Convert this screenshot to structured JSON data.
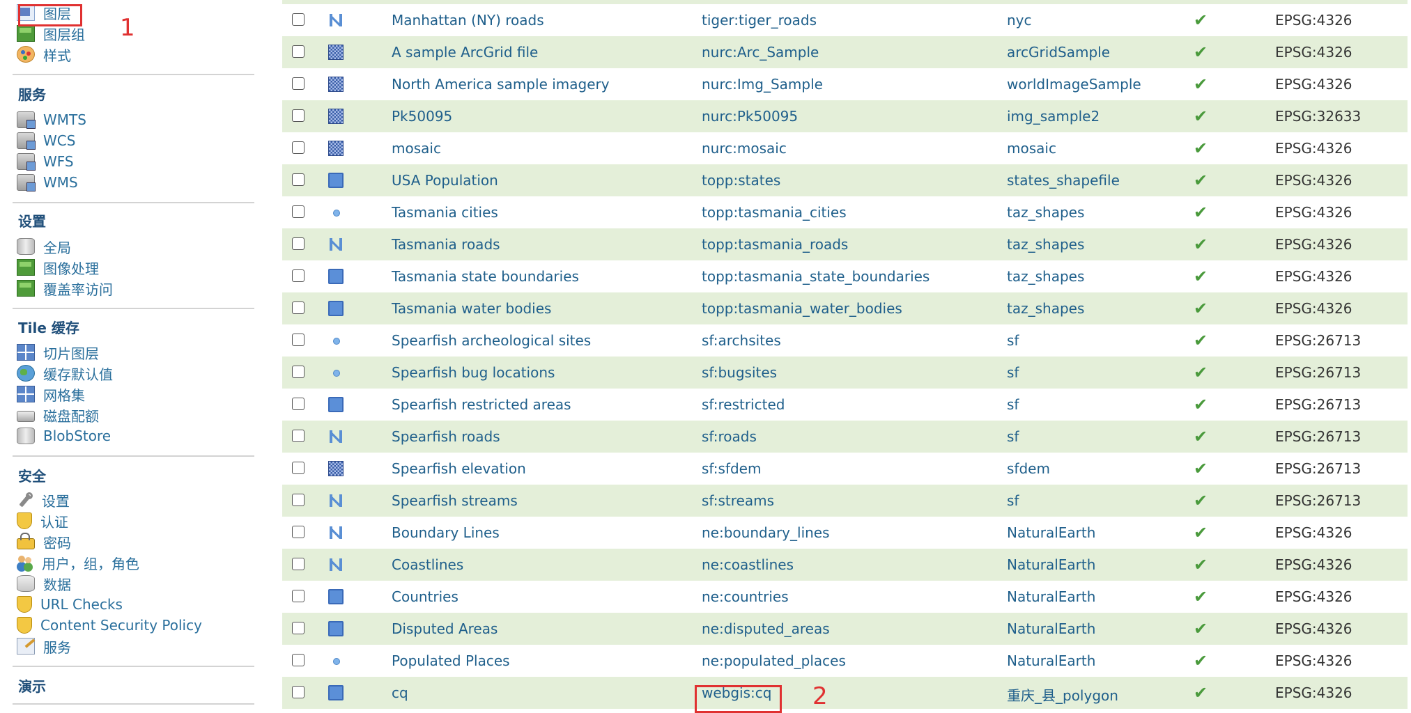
{
  "sidebar": {
    "data_items": [
      {
        "label": "图层",
        "icon": "layer-page-icon"
      },
      {
        "label": "图层组",
        "icon": "layer-group-icon"
      },
      {
        "label": "样式",
        "icon": "palette-icon"
      }
    ],
    "services": {
      "heading": "服务",
      "items": [
        {
          "label": "WMTS",
          "icon": "service-icon"
        },
        {
          "label": "WCS",
          "icon": "service-icon"
        },
        {
          "label": "WFS",
          "icon": "service-icon"
        },
        {
          "label": "WMS",
          "icon": "service-icon"
        }
      ]
    },
    "settings": {
      "heading": "设置",
      "items": [
        {
          "label": "全局",
          "icon": "server-icon"
        },
        {
          "label": "图像处理",
          "icon": "image-icon"
        },
        {
          "label": "覆盖率访问",
          "icon": "image-icon"
        }
      ]
    },
    "tile_cache": {
      "heading": "Tile 缓存",
      "items": [
        {
          "label": "切片图层",
          "icon": "tiles-icon"
        },
        {
          "label": "缓存默认值",
          "icon": "globe-icon"
        },
        {
          "label": "网格集",
          "icon": "grid-icon"
        },
        {
          "label": "磁盘配额",
          "icon": "disk-icon"
        },
        {
          "label": "BlobStore",
          "icon": "blobstore-icon"
        }
      ]
    },
    "security": {
      "heading": "安全",
      "items": [
        {
          "label": "设置",
          "icon": "wrench-icon"
        },
        {
          "label": "认证",
          "icon": "shield-icon"
        },
        {
          "label": "密码",
          "icon": "lock-icon"
        },
        {
          "label": "用户，组，角色",
          "icon": "users-icon"
        },
        {
          "label": "数据",
          "icon": "database-icon"
        },
        {
          "label": "URL Checks",
          "icon": "shield-icon"
        },
        {
          "label": "Content Security Policy",
          "icon": "shield-icon"
        },
        {
          "label": "服务",
          "icon": "edit-page-icon"
        }
      ]
    },
    "demo": {
      "heading": "演示"
    }
  },
  "layers": [
    {
      "title": "Manhattan (NY) roads",
      "name": "tiger:tiger_roads",
      "store": "nyc",
      "srs": "EPSG:4326",
      "type": "line"
    },
    {
      "title": "A sample ArcGrid file",
      "name": "nurc:Arc_Sample",
      "store": "arcGridSample",
      "srs": "EPSG:4326",
      "type": "raster"
    },
    {
      "title": "North America sample imagery",
      "name": "nurc:Img_Sample",
      "store": "worldImageSample",
      "srs": "EPSG:4326",
      "type": "raster"
    },
    {
      "title": "Pk50095",
      "name": "nurc:Pk50095",
      "store": "img_sample2",
      "srs": "EPSG:32633",
      "type": "raster"
    },
    {
      "title": "mosaic",
      "name": "nurc:mosaic",
      "store": "mosaic",
      "srs": "EPSG:4326",
      "type": "raster"
    },
    {
      "title": "USA Population",
      "name": "topp:states",
      "store": "states_shapefile",
      "srs": "EPSG:4326",
      "type": "polygon"
    },
    {
      "title": "Tasmania cities",
      "name": "topp:tasmania_cities",
      "store": "taz_shapes",
      "srs": "EPSG:4326",
      "type": "point"
    },
    {
      "title": "Tasmania roads",
      "name": "topp:tasmania_roads",
      "store": "taz_shapes",
      "srs": "EPSG:4326",
      "type": "line"
    },
    {
      "title": "Tasmania state boundaries",
      "name": "topp:tasmania_state_boundaries",
      "store": "taz_shapes",
      "srs": "EPSG:4326",
      "type": "polygon"
    },
    {
      "title": "Tasmania water bodies",
      "name": "topp:tasmania_water_bodies",
      "store": "taz_shapes",
      "srs": "EPSG:4326",
      "type": "polygon"
    },
    {
      "title": "Spearfish archeological sites",
      "name": "sf:archsites",
      "store": "sf",
      "srs": "EPSG:26713",
      "type": "point"
    },
    {
      "title": "Spearfish bug locations",
      "name": "sf:bugsites",
      "store": "sf",
      "srs": "EPSG:26713",
      "type": "point"
    },
    {
      "title": "Spearfish restricted areas",
      "name": "sf:restricted",
      "store": "sf",
      "srs": "EPSG:26713",
      "type": "polygon"
    },
    {
      "title": "Spearfish roads",
      "name": "sf:roads",
      "store": "sf",
      "srs": "EPSG:26713",
      "type": "line"
    },
    {
      "title": "Spearfish elevation",
      "name": "sf:sfdem",
      "store": "sfdem",
      "srs": "EPSG:26713",
      "type": "raster"
    },
    {
      "title": "Spearfish streams",
      "name": "sf:streams",
      "store": "sf",
      "srs": "EPSG:26713",
      "type": "line"
    },
    {
      "title": "Boundary Lines",
      "name": "ne:boundary_lines",
      "store": "NaturalEarth",
      "srs": "EPSG:4326",
      "type": "line"
    },
    {
      "title": "Coastlines",
      "name": "ne:coastlines",
      "store": "NaturalEarth",
      "srs": "EPSG:4326",
      "type": "line"
    },
    {
      "title": "Countries",
      "name": "ne:countries",
      "store": "NaturalEarth",
      "srs": "EPSG:4326",
      "type": "polygon"
    },
    {
      "title": "Disputed Areas",
      "name": "ne:disputed_areas",
      "store": "NaturalEarth",
      "srs": "EPSG:4326",
      "type": "polygon"
    },
    {
      "title": "Populated Places",
      "name": "ne:populated_places",
      "store": "NaturalEarth",
      "srs": "EPSG:4326",
      "type": "point"
    },
    {
      "title": "cq",
      "name": "webgis:cq",
      "store": "重庆_县_polygon",
      "srs": "EPSG:4326",
      "type": "polygon"
    }
  ],
  "enabled_mark": "✔",
  "annotations": {
    "first": "1",
    "second": "2"
  },
  "colors": {
    "annotation": "#e03131",
    "row_stripe": "#e4efd9",
    "link": "#1f5f8b",
    "check": "#4a9a3c"
  }
}
